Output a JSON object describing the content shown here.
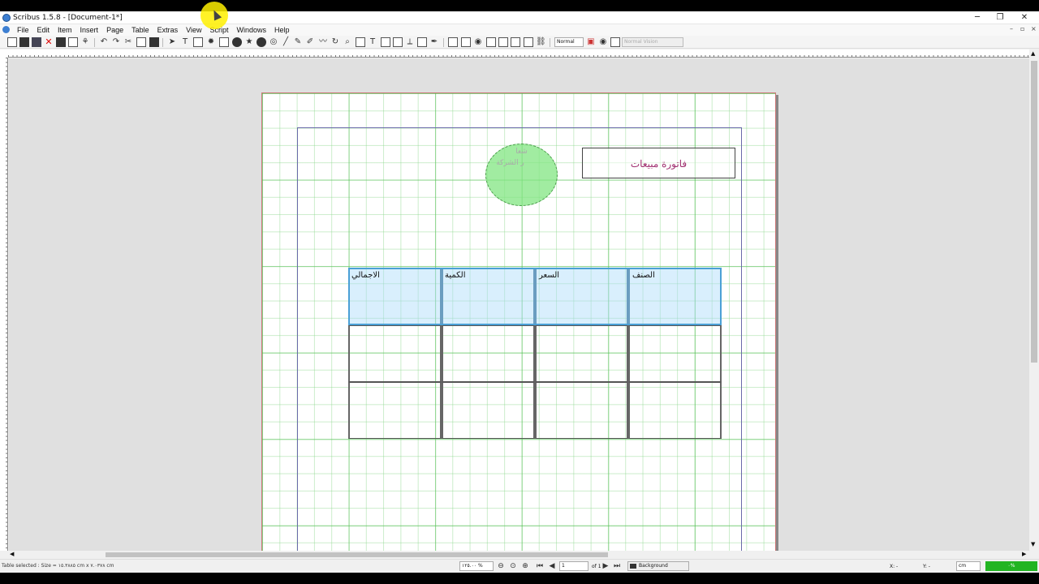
{
  "window": {
    "title": "Scribus 1.5.8 - [Document-1*]",
    "minimize": "─",
    "restore": "❐",
    "close": "✕"
  },
  "menu": [
    "File",
    "Edit",
    "Item",
    "Insert",
    "Page",
    "Table",
    "Extras",
    "View",
    "Script",
    "Windows",
    "Help"
  ],
  "toolbar": {
    "mode_select": "Normal",
    "vision_select": "Normal Vision"
  },
  "document": {
    "logo_text_line1": "شعا",
    "logo_text_line2": "ر الشركة",
    "invoice_title": "فاتورة مبيعات",
    "table": {
      "headers": [
        "الاجمالي",
        "الكمية",
        "السعر",
        "الصنف"
      ],
      "body_rows": 2
    }
  },
  "status": {
    "message": "Table selected : Size = ١٥.٣٨٨٥ cm x ٧.٠٣٧٨ cm",
    "zoom": "١٢٥.٠٠ %",
    "page_current": "1",
    "page_of": "of 1",
    "layer": "Background",
    "x_label": "X: -",
    "y_label": "Y: -",
    "unit": "cm",
    "progress": "٠%"
  },
  "colors": {
    "accent_title": "#a03070",
    "progress": "#22b422",
    "grid": "#50be50"
  }
}
